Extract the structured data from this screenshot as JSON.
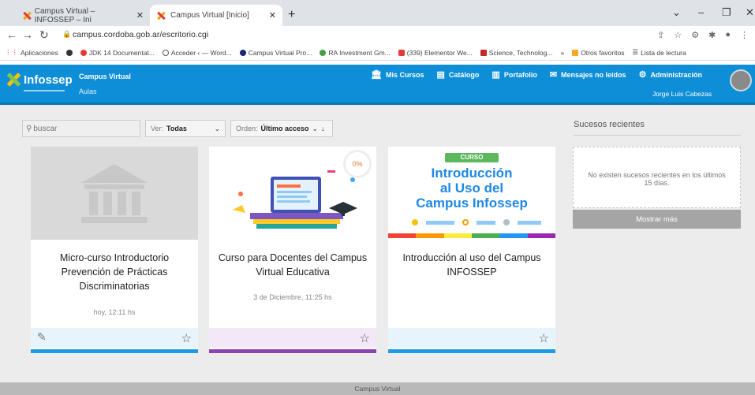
{
  "browser": {
    "tabs": [
      {
        "title": "Campus Virtual – INFOSSEP – Ini",
        "active": false
      },
      {
        "title": "Campus Virtual [Inicio]",
        "active": true
      }
    ],
    "url": "campus.cordoba.gob.ar/escritorio.cgi",
    "bookmarks": [
      "Aplicaciones",
      "JDK 14 Documentat...",
      "Acceder ‹ — Word...",
      "Campus Virtual Pro...",
      "RA Investment Gm...",
      "(339) Elementor We...",
      "Science, Technolog...",
      "»",
      "Otros favoritos",
      "Lista de lectura"
    ]
  },
  "app": {
    "logo_text": "Infossep",
    "site_title": "Campus Virtual",
    "site_subtitle": "Aulas",
    "nav": [
      {
        "label": "Mis Cursos",
        "icon": "institution-icon"
      },
      {
        "label": "Catálogo",
        "icon": "catalog-icon"
      },
      {
        "label": "Portafolio",
        "icon": "portfolio-icon"
      },
      {
        "label": "Mensajes no leídos",
        "icon": "mail-icon"
      },
      {
        "label": "Administración",
        "icon": "gear-icon"
      }
    ],
    "user_name": "Jorge Luis Cabezas"
  },
  "filters": {
    "search_placeholder": "buscar",
    "ver_label": "Ver:",
    "ver_value": "Todas",
    "orden_label": "Orden:",
    "orden_value": "Último acceso"
  },
  "courses": [
    {
      "title": "Micro-curso Introductorio Prevención de Prácticas Discriminatorias",
      "date": "hoy, 12:11 hs",
      "bar_color": "#1e9be0"
    },
    {
      "title": "Curso para Docentes del Campus Virtual Educativa",
      "date": "3 de Diciembre, 11:25 hs",
      "progress": "0%",
      "bar_color": "#8e44ad"
    },
    {
      "title": "Introducción al uso del Campus INFOSSEP",
      "date": "",
      "bar_color": "#1e9be0",
      "image": {
        "tag": "CURSO",
        "line1": "Introducción",
        "line2": "al Uso del",
        "line3": "Campus Infossep"
      }
    }
  ],
  "sucesos": {
    "title": "Sucesos recientes",
    "empty_text": "No existen sucesos recientes en los últimos 15 días.",
    "more_label": "Mostrar más"
  },
  "footer": {
    "text": "Campus Virtual"
  },
  "colors": {
    "brand_blue": "#0d8ed6",
    "accent_purple": "#8e44ad",
    "course_green": "#5cb85c"
  }
}
